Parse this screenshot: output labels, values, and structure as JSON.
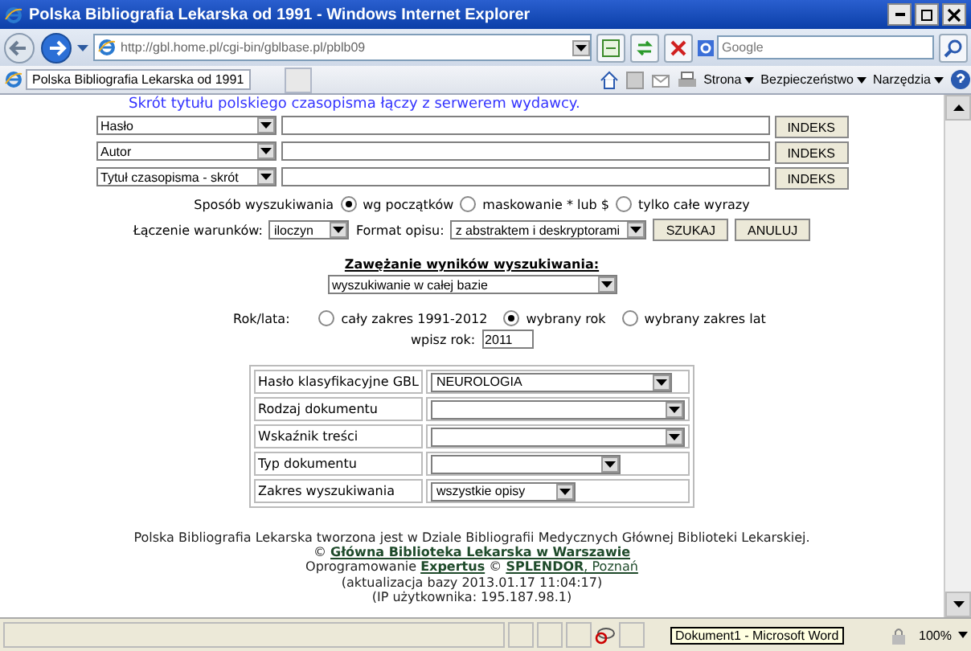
{
  "window": {
    "title": "Polska Bibliografia Lekarska od 1991 - Windows Internet Explorer"
  },
  "toolbar": {
    "address": "http://gbl.home.pl/cgi-bin/gblbase.pl/pblb09",
    "search_placeholder": "Google"
  },
  "tabs": [
    {
      "label": "Polska Bibliografia Lekarska od 1991",
      "selected": true
    }
  ],
  "command_bar": [
    "Strona",
    "Bezpieczeństwo",
    "Narzędzia"
  ],
  "page": {
    "note": "Skrót tytułu polskiego czasopisma łączy z serwerem wydawcy.",
    "search_rows": [
      {
        "field": "Hasło",
        "button": "INDEKS"
      },
      {
        "field": "Autor",
        "button": "INDEKS"
      },
      {
        "field": "Tytuł czasopisma - skrót",
        "button": "INDEKS"
      }
    ],
    "mode": {
      "label": "Sposób wyszukiwania",
      "options": [
        {
          "label": "wg początków",
          "selected": true
        },
        {
          "label": "maskowanie * lub $",
          "selected": false
        },
        {
          "label": "tylko całe wyrazy",
          "selected": false
        }
      ]
    },
    "combine": {
      "label": "Łączenie warunków:",
      "value": "iloczyn"
    },
    "format": {
      "label": "Format opisu:",
      "value": "z abstraktem i deskryptorami"
    },
    "buttons": [
      "SZUKAJ",
      "ANULUJ"
    ],
    "narrowing": {
      "heading": "Zawężanie wyników wyszukiwania:",
      "value": "wyszukiwanie w całej bazie"
    },
    "years": {
      "label": "Rok/lata:",
      "options": [
        {
          "label": "cały zakres 1991-2012",
          "selected": false
        },
        {
          "label": "wybrany rok",
          "selected": true
        },
        {
          "label": "wybrany zakres lat",
          "selected": false
        }
      ],
      "input_label": "wpisz rok:",
      "input_value": "2011"
    },
    "filters": [
      {
        "label": "Hasło klasyfikacyjne GBL",
        "value": "NEUROLOGIA"
      },
      {
        "label": "Rodzaj dokumentu"
      },
      {
        "label": "Wskaźnik treści"
      },
      {
        "label": "Typ dokumentu"
      },
      {
        "label": "Zakres wyszukiwania",
        "value": "wszystkie opisy"
      }
    ],
    "footer": {
      "line1": "Polska Bibliografia Lekarska tworzona jest w Dziale Bibliografii Medycznych Głównej Biblioteki Lekarskiej.",
      "copyright": "©",
      "library_link": "Główna Biblioteka Lekarska w Warszawie",
      "software_label": "Oprogramowanie",
      "software_link": "Expertus",
      "software_sep": "©",
      "vendor_link": "**SPLENDOR**, Poznań",
      "updated": "(aktualizacja bazy 2013.01.17 11:04:17)",
      "ip": "(IP użytkownika: 195.187.98.1)"
    }
  },
  "status_bar": {
    "tooltip": "Dokument1 - Microsoft Word",
    "zoom": "100%"
  }
}
